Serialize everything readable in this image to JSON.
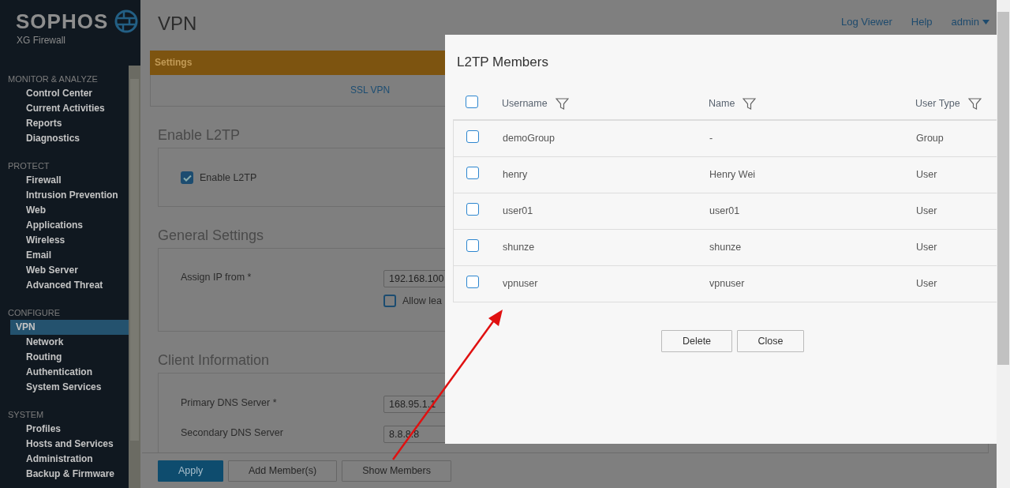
{
  "brand": {
    "name": "SOPHOS",
    "product": "XG Firewall"
  },
  "sidebar": {
    "sections": [
      {
        "title": "MONITOR & ANALYZE",
        "items": [
          {
            "label": "Control Center",
            "selected": false
          },
          {
            "label": "Current Activities",
            "selected": false
          },
          {
            "label": "Reports",
            "selected": false
          },
          {
            "label": "Diagnostics",
            "selected": false
          }
        ]
      },
      {
        "title": "PROTECT",
        "items": [
          {
            "label": "Firewall",
            "selected": false
          },
          {
            "label": "Intrusion Prevention",
            "selected": false
          },
          {
            "label": "Web",
            "selected": false
          },
          {
            "label": "Applications",
            "selected": false
          },
          {
            "label": "Wireless",
            "selected": false
          },
          {
            "label": "Email",
            "selected": false
          },
          {
            "label": "Web Server",
            "selected": false
          },
          {
            "label": "Advanced Threat",
            "selected": false
          }
        ]
      },
      {
        "title": "CONFIGURE",
        "items": [
          {
            "label": "VPN",
            "selected": true
          },
          {
            "label": "Network",
            "selected": false
          },
          {
            "label": "Routing",
            "selected": false
          },
          {
            "label": "Authentication",
            "selected": false
          },
          {
            "label": "System Services",
            "selected": false
          }
        ]
      },
      {
        "title": "SYSTEM",
        "items": [
          {
            "label": "Profiles",
            "selected": false
          },
          {
            "label": "Hosts and Services",
            "selected": false
          },
          {
            "label": "Administration",
            "selected": false
          },
          {
            "label": "Backup & Firmware",
            "selected": false
          }
        ]
      }
    ]
  },
  "header": {
    "title": "VPN",
    "links": [
      "Log Viewer",
      "Help"
    ],
    "user": "admin"
  },
  "settings_bar": {
    "label": "Settings"
  },
  "tabs": [
    {
      "label": "SSL VPN"
    }
  ],
  "sections": [
    {
      "title": "Enable L2TP",
      "fields": [
        {
          "kind": "checkbox",
          "label": "Enable L2TP",
          "checked": true
        }
      ]
    },
    {
      "title": "General Settings",
      "fields": [
        {
          "kind": "input",
          "label": "Assign IP from *",
          "value": "192.168.100"
        },
        {
          "kind": "checkbox-right",
          "label": "Allow lea",
          "checked": false
        }
      ]
    },
    {
      "title": "Client Information",
      "fields": [
        {
          "kind": "input",
          "label": "Primary DNS Server *",
          "value": "168.95.1.1"
        },
        {
          "kind": "input",
          "label": "Secondary DNS Server",
          "value": "8.8.8.8"
        }
      ]
    }
  ],
  "footer_buttons": [
    {
      "label": "Apply",
      "primary": true
    },
    {
      "label": "Add Member(s)",
      "primary": false
    },
    {
      "label": "Show Members",
      "primary": false
    }
  ],
  "dialog": {
    "title": "L2TP Members",
    "header_checked": false,
    "columns": [
      "Username",
      "Name",
      "User Type"
    ],
    "rows": [
      {
        "cells": [
          "demoGroup",
          "-",
          "Group"
        ],
        "checked": false
      },
      {
        "cells": [
          "henry",
          "Henry Wei",
          "User"
        ],
        "checked": false
      },
      {
        "cells": [
          "user01",
          "user01",
          "User"
        ],
        "checked": false
      },
      {
        "cells": [
          "shunze",
          "shunze",
          "User"
        ],
        "checked": false
      },
      {
        "cells": [
          "vpnuser",
          "vpnuser",
          "User"
        ],
        "checked": false
      }
    ],
    "buttons": [
      "Delete",
      "Close"
    ]
  }
}
